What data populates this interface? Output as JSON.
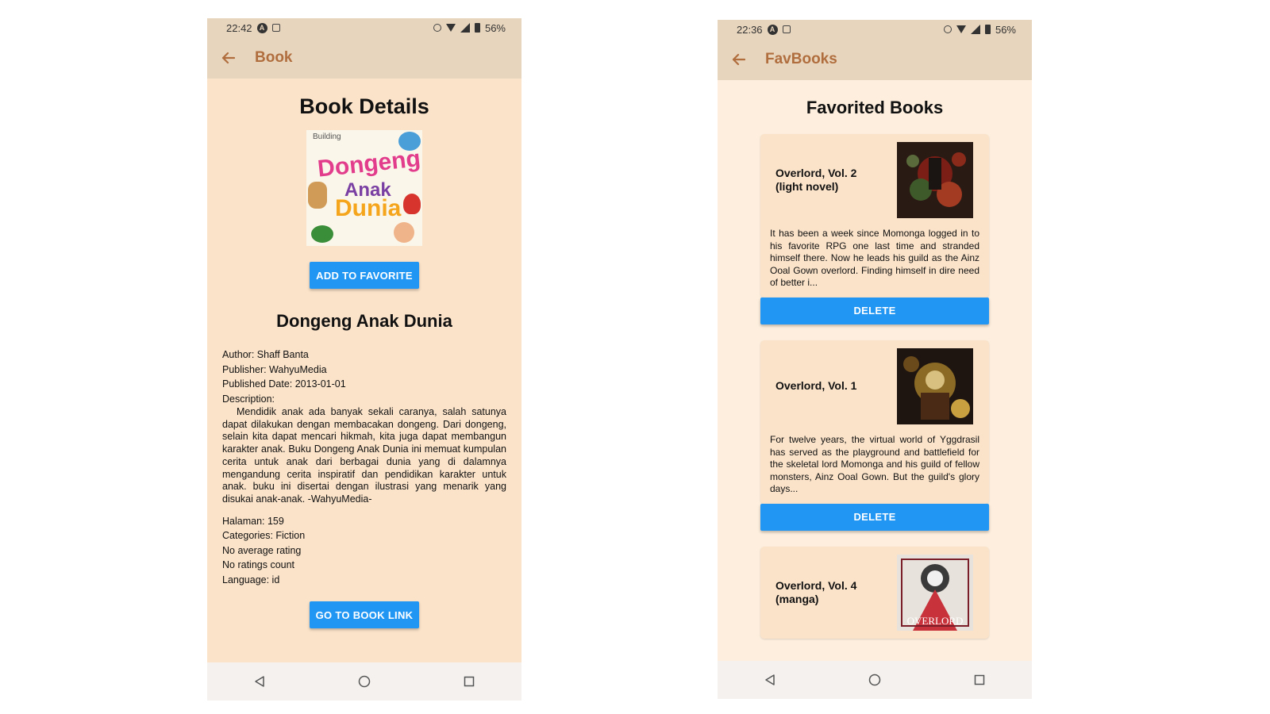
{
  "left": {
    "status": {
      "time": "22:42",
      "battery": "56%"
    },
    "appbar": {
      "title": "Book"
    },
    "heading": "Book Details",
    "cover": {
      "brand": "Building",
      "line1": "Dongeng",
      "line2": "Anak",
      "line3": "Dunia"
    },
    "add_favorite_label": "ADD TO FAVORITE",
    "book_title": "Dongeng Anak Dunia",
    "author": "Author: Shaff Banta",
    "publisher": "Publisher: WahyuMedia",
    "published_date": "Published Date: 2013-01-01",
    "description_label": "Description:",
    "description": "Mendidik anak ada banyak sekali caranya, salah satunya dapat dilakukan dengan membacakan dongeng. Dari dongeng, selain kita dapat mencari hikmah, kita juga dapat membangun karakter anak. Buku Dongeng Anak Dunia ini memuat kumpulan cerita untuk anak dari berbagai dunia yang di dalamnya mengandung cerita inspiratif dan pendidikan karakter untuk anak. buku ini disertai dengan ilustrasi yang menarik yang disukai anak-anak. -WahyuMedia-",
    "pages": "Halaman: 159",
    "categories": "Categories: Fiction",
    "avg_rating": "No average rating",
    "ratings_count": "No ratings count",
    "language": "Language: id",
    "book_link_label": "GO TO BOOK LINK"
  },
  "right": {
    "status": {
      "time": "22:36",
      "battery": "56%"
    },
    "appbar": {
      "title": "FavBooks"
    },
    "heading": "Favorited Books",
    "delete_label": "DELETE",
    "books": [
      {
        "title": "Overlord, Vol. 2 (light novel)",
        "description": "It has been a week since Momonga logged in to his favorite RPG one last time and stranded himself there. Now he leads his guild as the Ainz Ooal Gown overlord. Finding himself in dire need of better i..."
      },
      {
        "title": "Overlord, Vol. 1",
        "description": "For twelve years, the virtual world of Yggdrasil has served as the playground and battlefield for the skeletal lord Momonga and his guild of fellow monsters, Ainz Ooal Gown. But the guild's glory days..."
      },
      {
        "title": "Overlord, Vol. 4 (manga)",
        "cover_text": "OVERLORD"
      }
    ]
  },
  "colors": {
    "accent": "#2196f3",
    "appbar_bg": "#e8d5bd",
    "title_brown": "#b06e3e",
    "content_bg": "#fbe3c9"
  }
}
